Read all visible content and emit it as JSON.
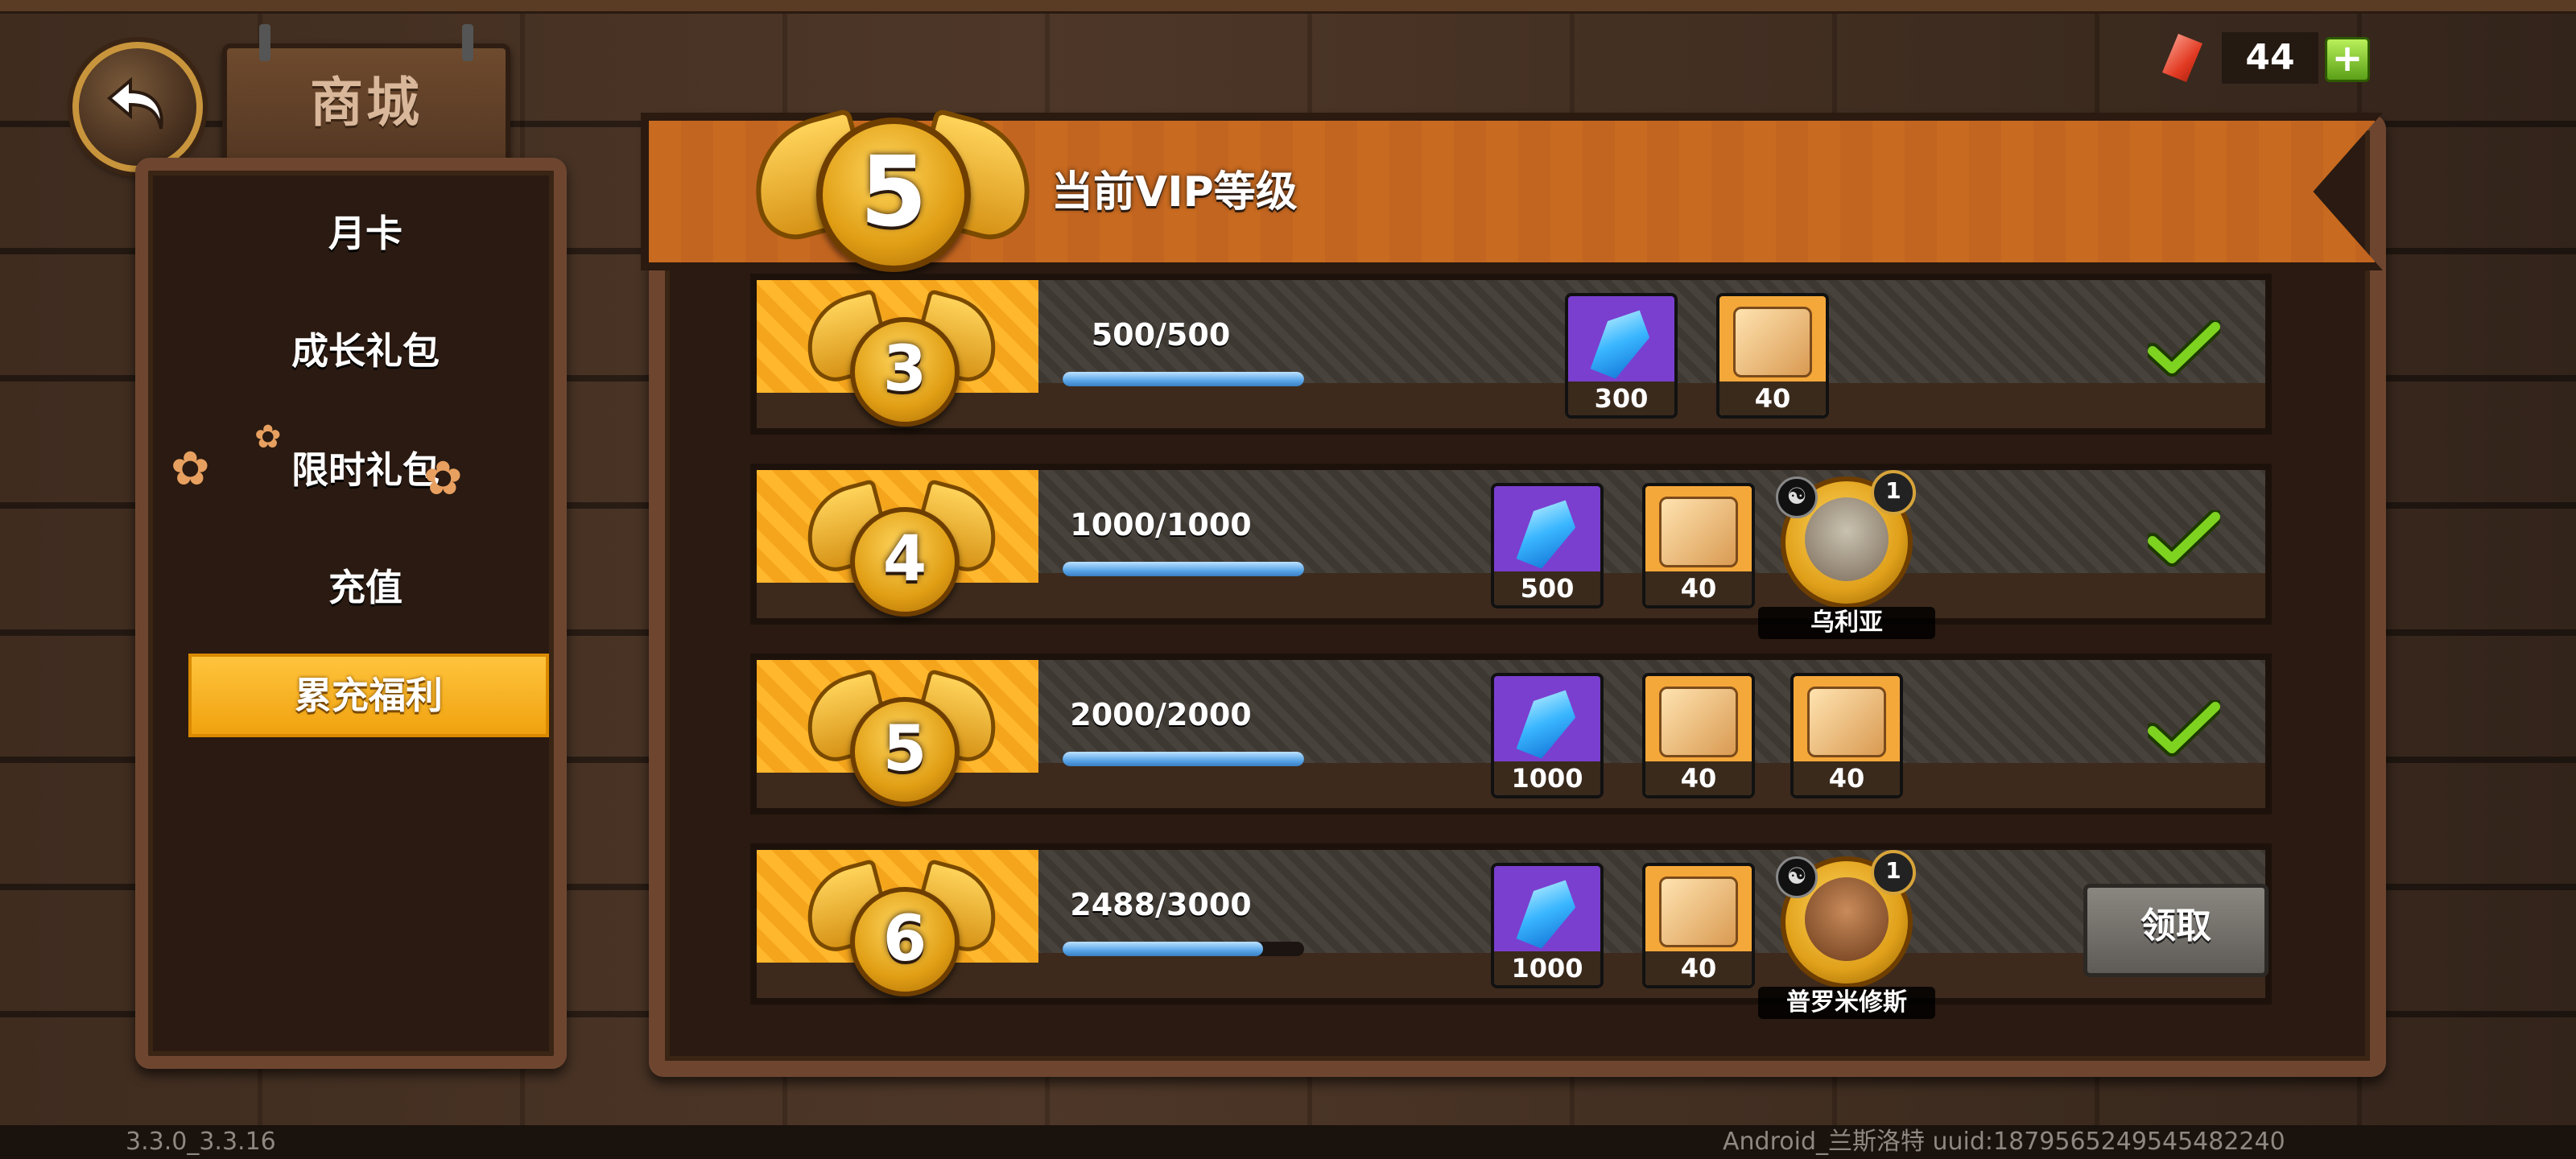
{
  "header": {
    "title": "商城",
    "currency_value": "44",
    "add_label": "+"
  },
  "nav": {
    "items": [
      {
        "label": "月卡"
      },
      {
        "label": "成长礼包"
      },
      {
        "label": "限时礼包"
      },
      {
        "label": "充值"
      },
      {
        "label": "累充福利",
        "active": true
      }
    ]
  },
  "vip": {
    "current_level": "5",
    "banner_label": "当前VIP等级",
    "rows": [
      {
        "level": "3",
        "progress_text": "500/500",
        "progress": 1.0,
        "rewards": [
          {
            "kind": "gem",
            "qty": "300"
          },
          {
            "kind": "puzzle",
            "qty": "40"
          }
        ],
        "status": "claimed"
      },
      {
        "level": "4",
        "progress_text": "1000/1000",
        "progress": 1.0,
        "rewards": [
          {
            "kind": "gem",
            "qty": "500"
          },
          {
            "kind": "puzzle",
            "qty": "40"
          }
        ],
        "hero": {
          "name": "乌利亚",
          "level": "1"
        },
        "status": "claimed"
      },
      {
        "level": "5",
        "progress_text": "2000/2000",
        "progress": 1.0,
        "rewards": [
          {
            "kind": "gem",
            "qty": "1000"
          },
          {
            "kind": "puzzle",
            "qty": "40"
          },
          {
            "kind": "puzzle",
            "qty": "40"
          }
        ],
        "status": "claimed"
      },
      {
        "level": "6",
        "progress_text": "2488/3000",
        "progress": 0.829,
        "rewards": [
          {
            "kind": "gem",
            "qty": "1000"
          },
          {
            "kind": "puzzle",
            "qty": "40"
          }
        ],
        "hero": {
          "name": "普罗米修斯",
          "level": "1"
        },
        "status": "claim",
        "claim_label": "领取"
      }
    ]
  },
  "footer": {
    "version": "3.3.0_3.3.16",
    "device": "Android_兰斯洛特 uuid:1879565249545482240"
  },
  "colors": {
    "accent": "#f5a51c",
    "check": "#7ed321",
    "gem_bg": "#7a3fcf",
    "puzzle_bg": "#f5a83a"
  }
}
